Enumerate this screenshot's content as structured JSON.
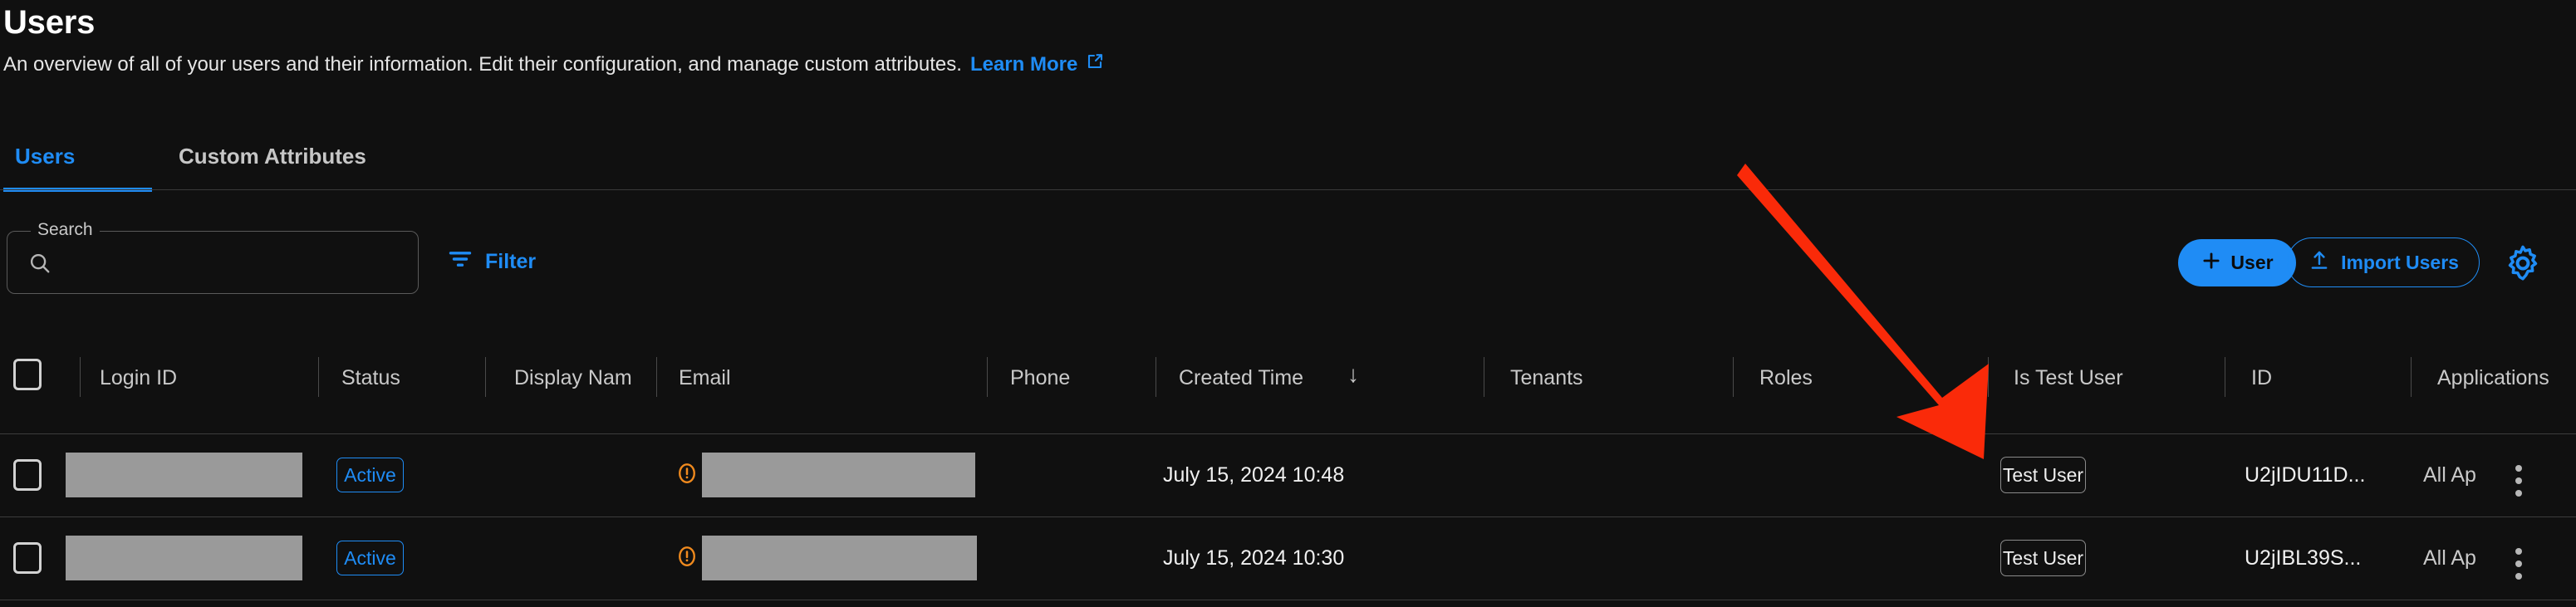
{
  "header": {
    "title": "Users",
    "subtitle": "An overview of all of your users and their information. Edit their configuration, and manage custom attributes.",
    "learn_more_label": "Learn More",
    "learn_more_icon": "external-link-icon"
  },
  "tabs": [
    {
      "label": "Users",
      "active": true
    },
    {
      "label": "Custom Attributes",
      "active": false
    }
  ],
  "toolbar": {
    "search_legend": "Search",
    "search_value": "",
    "search_placeholder": "",
    "search_icon": "search-icon",
    "filter_label": "Filter",
    "filter_icon": "filter-icon",
    "add_user_label": "User",
    "add_user_icon": "plus-icon",
    "import_users_label": "Import Users",
    "import_users_icon": "upload-icon",
    "settings_icon": "gear-icon"
  },
  "table": {
    "select_all_checkbox": false,
    "columns": [
      {
        "label": "Login ID"
      },
      {
        "label": "Status"
      },
      {
        "label": "Display Nam"
      },
      {
        "label": "Email"
      },
      {
        "label": "Phone"
      },
      {
        "label": "Created Time",
        "sorted": "desc",
        "sort_icon": "arrow-down-icon"
      },
      {
        "label": "Tenants"
      },
      {
        "label": "Roles"
      },
      {
        "label": "Is Test User"
      },
      {
        "label": "ID"
      },
      {
        "label": "Applications"
      }
    ],
    "rows": [
      {
        "checked": false,
        "login_id": "",
        "login_id_redacted": true,
        "status": "Active",
        "display_name": "",
        "email": "",
        "email_redacted": true,
        "email_warning_icon": "warning-circle-icon",
        "phone": "",
        "created_time": "July 15, 2024 10:48",
        "tenants": "",
        "roles": "",
        "is_test_user": "Test User",
        "id": "U2jIDU11D...",
        "applications": "All Ap",
        "menu_icon": "more-vertical-icon"
      },
      {
        "checked": false,
        "login_id": "",
        "login_id_redacted": true,
        "status": "Active",
        "display_name": "",
        "email": "",
        "email_redacted": true,
        "email_warning_icon": "warning-circle-icon",
        "phone": "",
        "created_time": "July 15, 2024 10:30",
        "tenants": "",
        "roles": "",
        "is_test_user": "Test User",
        "id": "U2jIBL39S...",
        "applications": "All Ap",
        "menu_icon": "more-vertical-icon"
      }
    ]
  },
  "annotation": {
    "arrow_icon": "red-arrow-annotation",
    "color": "#fa2a09"
  },
  "colors": {
    "background": "#101010",
    "accent": "#1f8cf5",
    "text": "#e8e8e8",
    "muted_text": "#c9c9c9",
    "divider": "#3c3c3c",
    "redacted": "#9a9a9a",
    "warning": "#f08a1e",
    "annotation_red": "#fa2a09"
  }
}
